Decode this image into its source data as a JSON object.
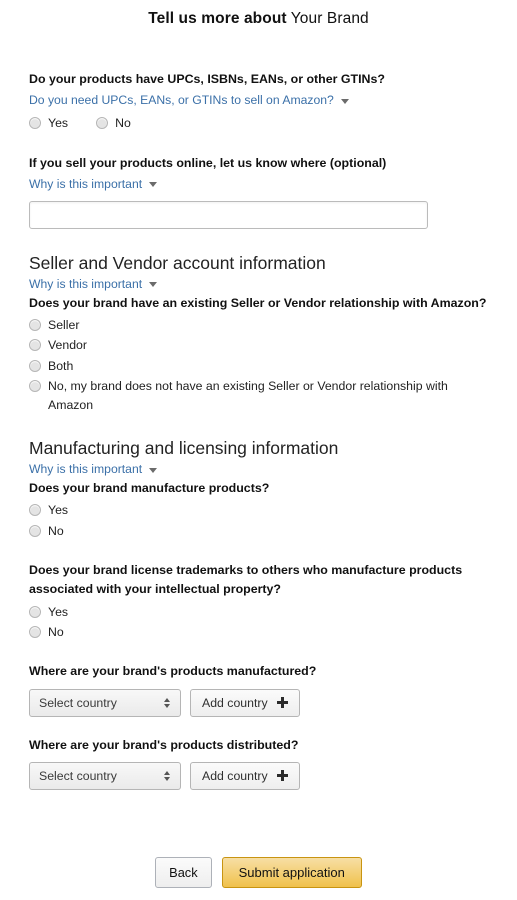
{
  "header": {
    "title_bold": "Tell us more about",
    "title_normal": " Your Brand"
  },
  "gtin": {
    "question": "Do your products have UPCs, ISBNs, EANs, or other GTINs?",
    "expander_label": "Do you need UPCs, EANs, or GTINs to sell on Amazon?",
    "options": [
      {
        "label": "Yes"
      },
      {
        "label": "No"
      }
    ]
  },
  "online_sales": {
    "question": "If you sell your products online, let us know where (optional)",
    "expander_label": "Why is this important",
    "input_value": "",
    "input_placeholder": ""
  },
  "seller_vendor": {
    "section_title": "Seller and Vendor account information",
    "expander_label": "Why is this important",
    "question": "Does your brand have an existing Seller or Vendor relationship with Amazon?",
    "options": [
      {
        "label": "Seller"
      },
      {
        "label": "Vendor"
      },
      {
        "label": "Both"
      },
      {
        "label": "No, my brand does not have an existing Seller or Vendor relationship with Amazon"
      }
    ]
  },
  "manufacturing": {
    "section_title": "Manufacturing and licensing information",
    "expander_label": "Why is this important",
    "manufacture_question": "Does your brand manufacture products?",
    "manufacture_options": [
      {
        "label": "Yes"
      },
      {
        "label": "No"
      }
    ],
    "license_question": "Does your brand license trademarks to others who manufacture products associated with your intellectual property?",
    "license_options": [
      {
        "label": "Yes"
      },
      {
        "label": "No"
      }
    ],
    "manufactured_where_question": "Where are your brand's products manufactured?",
    "manufactured_select_value": "Select country",
    "manufactured_add_label": "Add country",
    "distributed_where_question": "Where are your brand's products distributed?",
    "distributed_select_value": "Select country",
    "distributed_add_label": "Add country"
  },
  "footer": {
    "back_label": "Back",
    "submit_label": "Submit application"
  },
  "colors": {
    "link_blue": "#3b70a8",
    "submit_gold": "#f0c14b",
    "submit_border": "#c89411",
    "text_dark": "#111111"
  }
}
